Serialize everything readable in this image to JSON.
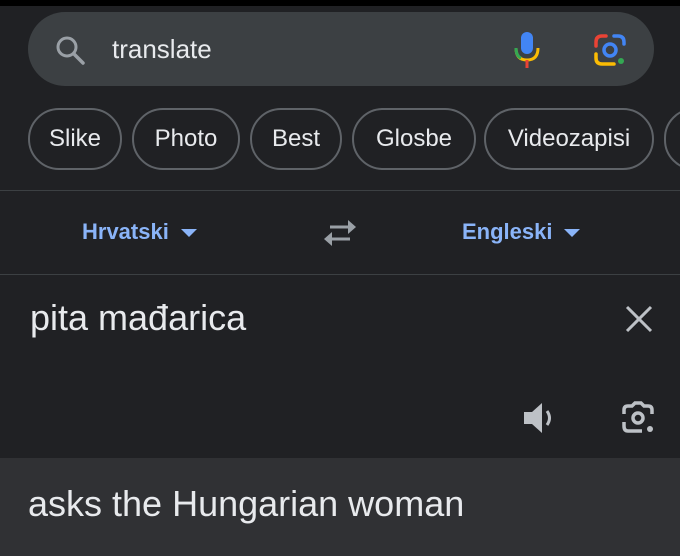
{
  "search": {
    "query": "translate",
    "icons": {
      "search": "search-icon",
      "mic": "microphone-icon",
      "lens": "google-lens-icon"
    }
  },
  "chips": [
    {
      "label": "Slike"
    },
    {
      "label": "Photo"
    },
    {
      "label": "Best"
    },
    {
      "label": "Glosbe"
    },
    {
      "label": "Videozapisi"
    }
  ],
  "translator": {
    "source_lang": "Hrvatski",
    "target_lang": "Engleski",
    "source_text": "pita mađarica",
    "translation": "asks the Hungarian woman",
    "icons": {
      "swap": "swap-languages-icon",
      "clear": "close-icon",
      "listen": "speaker-icon",
      "camera": "camera-icon"
    }
  },
  "colors": {
    "background": "#202124",
    "search_bar": "#3c4043",
    "accent_link": "#8ab4f8",
    "text": "#e8eaed",
    "result_bg": "#303134"
  }
}
